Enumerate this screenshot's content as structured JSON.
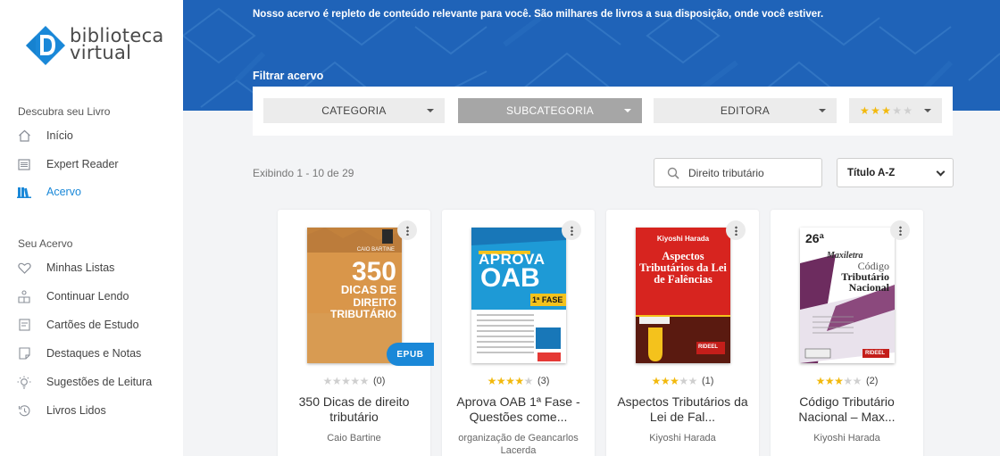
{
  "logo": {
    "line1": "biblioteca",
    "line2": "virtual"
  },
  "sidebar": {
    "section1_title": "Descubra seu Livro",
    "section1_items": [
      {
        "label": "Início",
        "icon": "home-icon"
      },
      {
        "label": "Expert Reader",
        "icon": "list-icon"
      },
      {
        "label": "Acervo",
        "icon": "bookshelf-icon",
        "active": true
      }
    ],
    "section2_title": "Seu Acervo",
    "section2_items": [
      {
        "label": "Minhas Listas",
        "icon": "heart-icon"
      },
      {
        "label": "Continuar Lendo",
        "icon": "reader-icon"
      },
      {
        "label": "Cartões de Estudo",
        "icon": "card-icon"
      },
      {
        "label": "Destaques e Notas",
        "icon": "note-icon"
      },
      {
        "label": "Sugestões de Leitura",
        "icon": "lightbulb-icon"
      },
      {
        "label": "Livros Lidos",
        "icon": "history-icon"
      }
    ]
  },
  "hero": {
    "description": "Nosso acervo é repleto de conteúdo relevante para você. São milhares de livros a sua disposição, onde você estiver.",
    "filter_label": "Filtrar acervo"
  },
  "filters": {
    "categoria": "CATEGORIA",
    "subcategoria": "SUBCATEGORIA",
    "editora": "EDITORA",
    "rating_filled": 3,
    "rating_total": 5
  },
  "results": {
    "count_text": "Exibindo 1 - 10 de 29",
    "search_value": "Direito tributário",
    "sort_value": "Título A-Z"
  },
  "books": [
    {
      "title": "350 Dicas de direito tributário",
      "author": "Caio Bartine",
      "rating": 0,
      "reviews": "(0)",
      "badge": "EPUB",
      "cover": {
        "top": "350",
        "middle": "DICAS DE",
        "bottom": "DIREITO TRIBUTÁRIO",
        "author": "CAIO BARTINE"
      }
    },
    {
      "title": "Aprova OAB 1ª Fase - Questões come...",
      "author": "organização de Geancarlos Lacerda",
      "rating": 4,
      "reviews": "(3)",
      "cover": {
        "top": "APROVA",
        "middle": "OAB",
        "bottom": "1ª FASE"
      }
    },
    {
      "title": "Aspectos Tributários da Lei de Fal...",
      "author": "Kiyoshi Harada",
      "rating": 3,
      "reviews": "(1)",
      "cover": {
        "author": "Kiyoshi Harada",
        "title": "Aspectos Tributários da Lei de Falências",
        "publisher": "RIDEEL"
      }
    },
    {
      "title": "Código Tributário Nacional – Max...",
      "author": "Kiyoshi Harada",
      "rating": 3,
      "reviews": "(2)",
      "cover": {
        "edition": "26ª",
        "line1": "Maxiletra",
        "line2": "Código",
        "line3": "Tributário",
        "line4": "Nacional",
        "publisher": "RIDEEL"
      }
    }
  ],
  "colors": {
    "accent": "#1a88d8",
    "hero_bg": "#1f63b8",
    "star": "#f2b90d"
  }
}
